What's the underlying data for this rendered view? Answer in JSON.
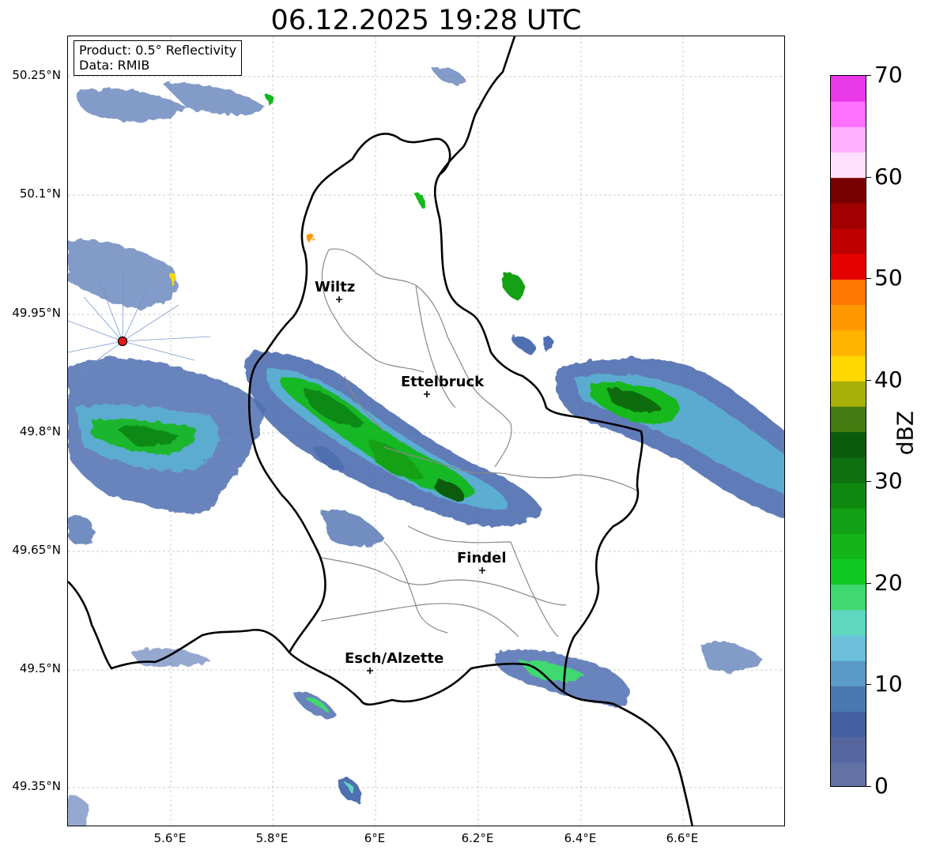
{
  "title": "06.12.2025 19:28 UTC",
  "info": {
    "product": "Product: 0.5° Reflectivity",
    "data_source": "Data: RMIB"
  },
  "lat_axis": [
    "50.25°N",
    "50.1°N",
    "49.95°N",
    "49.8°N",
    "49.65°N",
    "49.5°N",
    "49.35°N"
  ],
  "lon_axis": [
    "5.6°E",
    "5.8°E",
    "6°E",
    "6.2°E",
    "6.4°E",
    "6.6°E"
  ],
  "cities": [
    {
      "name": "Wiltz"
    },
    {
      "name": "Ettelbruck"
    },
    {
      "name": "Findel"
    },
    {
      "name": "Esch/Alzette"
    }
  ],
  "radar_site": {
    "marker_color": "#e31a1c"
  },
  "colorbar": {
    "label": "dBZ",
    "min": 0,
    "max": 70,
    "tick_labels": [
      "0",
      "10",
      "20",
      "30",
      "40",
      "50",
      "60",
      "70"
    ],
    "colors": [
      "#6272a4",
      "#5566a0",
      "#4560a0",
      "#4a78b0",
      "#5a9ac6",
      "#6cc0dc",
      "#60d8c0",
      "#40d870",
      "#10c820",
      "#12b418",
      "#11a016",
      "#108810",
      "#0e7010",
      "#0a5c0c",
      "#457a10",
      "#aab00a",
      "#ffd800",
      "#ffb400",
      "#ff9800",
      "#ff7800",
      "#e60000",
      "#c00000",
      "#a00000",
      "#780000",
      "#ffe0ff",
      "#ffb0ff",
      "#ff70ff",
      "#e838e8"
    ]
  },
  "echoes": [
    {
      "id": "west-cluster",
      "dbz_range": [
        0,
        30
      ]
    },
    {
      "id": "central-band",
      "dbz_range": [
        0,
        35
      ]
    },
    {
      "id": "east-band",
      "dbz_range": [
        0,
        35
      ]
    },
    {
      "id": "southeast-band",
      "dbz_range": [
        0,
        25
      ]
    },
    {
      "id": "scattered-north",
      "dbz_range": [
        0,
        45
      ]
    }
  ]
}
